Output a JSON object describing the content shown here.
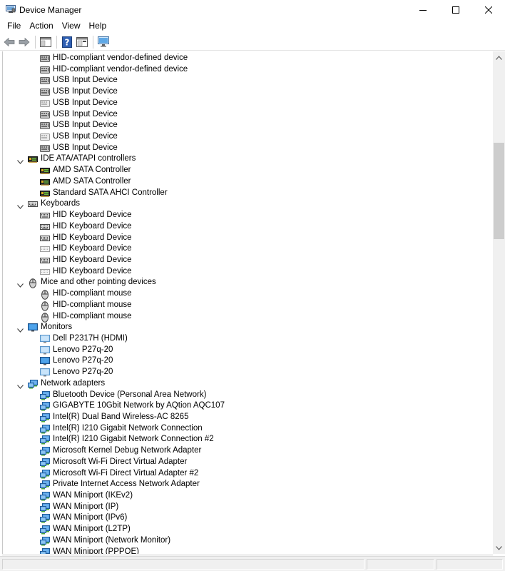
{
  "window": {
    "title": "Device Manager"
  },
  "menu": [
    "File",
    "Action",
    "View",
    "Help"
  ],
  "toolbar": [
    "back-arrow-icon",
    "forward-arrow-icon",
    "properties-icon",
    "help-icon",
    "show-hide-icon",
    "scan-hardware-icon"
  ],
  "tree": [
    {
      "kind": "dev",
      "label": "HID-compliant vendor-defined device",
      "icon": "hid"
    },
    {
      "kind": "dev",
      "label": "HID-compliant vendor-defined device",
      "icon": "hid"
    },
    {
      "kind": "dev",
      "label": "USB Input Device",
      "icon": "hid"
    },
    {
      "kind": "dev",
      "label": "USB Input Device",
      "icon": "hid"
    },
    {
      "kind": "dev",
      "label": "USB Input Device",
      "icon": "hid-light"
    },
    {
      "kind": "dev",
      "label": "USB Input Device",
      "icon": "hid"
    },
    {
      "kind": "dev",
      "label": "USB Input Device",
      "icon": "hid"
    },
    {
      "kind": "dev",
      "label": "USB Input Device",
      "icon": "hid-light"
    },
    {
      "kind": "dev",
      "label": "USB Input Device",
      "icon": "hid"
    },
    {
      "kind": "cat",
      "label": "IDE ATA/ATAPI controllers",
      "icon": "ide"
    },
    {
      "kind": "dev",
      "label": "AMD SATA Controller",
      "icon": "ide"
    },
    {
      "kind": "dev",
      "label": "AMD SATA Controller",
      "icon": "ide"
    },
    {
      "kind": "dev",
      "label": "Standard SATA AHCI Controller",
      "icon": "ide"
    },
    {
      "kind": "cat",
      "label": "Keyboards",
      "icon": "keyboard"
    },
    {
      "kind": "dev",
      "label": "HID Keyboard Device",
      "icon": "keyboard"
    },
    {
      "kind": "dev",
      "label": "HID Keyboard Device",
      "icon": "keyboard"
    },
    {
      "kind": "dev",
      "label": "HID Keyboard Device",
      "icon": "keyboard"
    },
    {
      "kind": "dev",
      "label": "HID Keyboard Device",
      "icon": "keyboard-light"
    },
    {
      "kind": "dev",
      "label": "HID Keyboard Device",
      "icon": "keyboard"
    },
    {
      "kind": "dev",
      "label": "HID Keyboard Device",
      "icon": "keyboard-light"
    },
    {
      "kind": "cat",
      "label": "Mice and other pointing devices",
      "icon": "mouse"
    },
    {
      "kind": "dev",
      "label": "HID-compliant mouse",
      "icon": "mouse"
    },
    {
      "kind": "dev",
      "label": "HID-compliant mouse",
      "icon": "mouse"
    },
    {
      "kind": "dev",
      "label": "HID-compliant mouse",
      "icon": "mouse"
    },
    {
      "kind": "cat",
      "label": "Monitors",
      "icon": "monitor"
    },
    {
      "kind": "dev",
      "label": "Dell P2317H (HDMI)",
      "icon": "monitor-light"
    },
    {
      "kind": "dev",
      "label": "Lenovo P27q-20",
      "icon": "monitor-light"
    },
    {
      "kind": "dev",
      "label": "Lenovo P27q-20",
      "icon": "monitor"
    },
    {
      "kind": "dev",
      "label": "Lenovo P27q-20",
      "icon": "monitor-light"
    },
    {
      "kind": "cat",
      "label": "Network adapters",
      "icon": "network"
    },
    {
      "kind": "dev",
      "label": "Bluetooth Device (Personal Area Network)",
      "icon": "network"
    },
    {
      "kind": "dev",
      "label": "GIGABYTE 10Gbit Network by AQtion AQC107",
      "icon": "network"
    },
    {
      "kind": "dev",
      "label": "Intel(R) Dual Band Wireless-AC 8265",
      "icon": "network"
    },
    {
      "kind": "dev",
      "label": "Intel(R) I210 Gigabit Network Connection",
      "icon": "network"
    },
    {
      "kind": "dev",
      "label": "Intel(R) I210 Gigabit Network Connection #2",
      "icon": "network"
    },
    {
      "kind": "dev",
      "label": "Microsoft Kernel Debug Network Adapter",
      "icon": "network"
    },
    {
      "kind": "dev",
      "label": "Microsoft Wi-Fi Direct Virtual Adapter",
      "icon": "network"
    },
    {
      "kind": "dev",
      "label": "Microsoft Wi-Fi Direct Virtual Adapter #2",
      "icon": "network"
    },
    {
      "kind": "dev",
      "label": "Private Internet Access Network Adapter",
      "icon": "network"
    },
    {
      "kind": "dev",
      "label": "WAN Miniport (IKEv2)",
      "icon": "network"
    },
    {
      "kind": "dev",
      "label": "WAN Miniport (IP)",
      "icon": "network"
    },
    {
      "kind": "dev",
      "label": "WAN Miniport (IPv6)",
      "icon": "network"
    },
    {
      "kind": "dev",
      "label": "WAN Miniport (L2TP)",
      "icon": "network"
    },
    {
      "kind": "dev",
      "label": "WAN Miniport (Network Monitor)",
      "icon": "network"
    },
    {
      "kind": "dev",
      "label": "WAN Miniport (PPPOE)",
      "icon": "network"
    }
  ]
}
